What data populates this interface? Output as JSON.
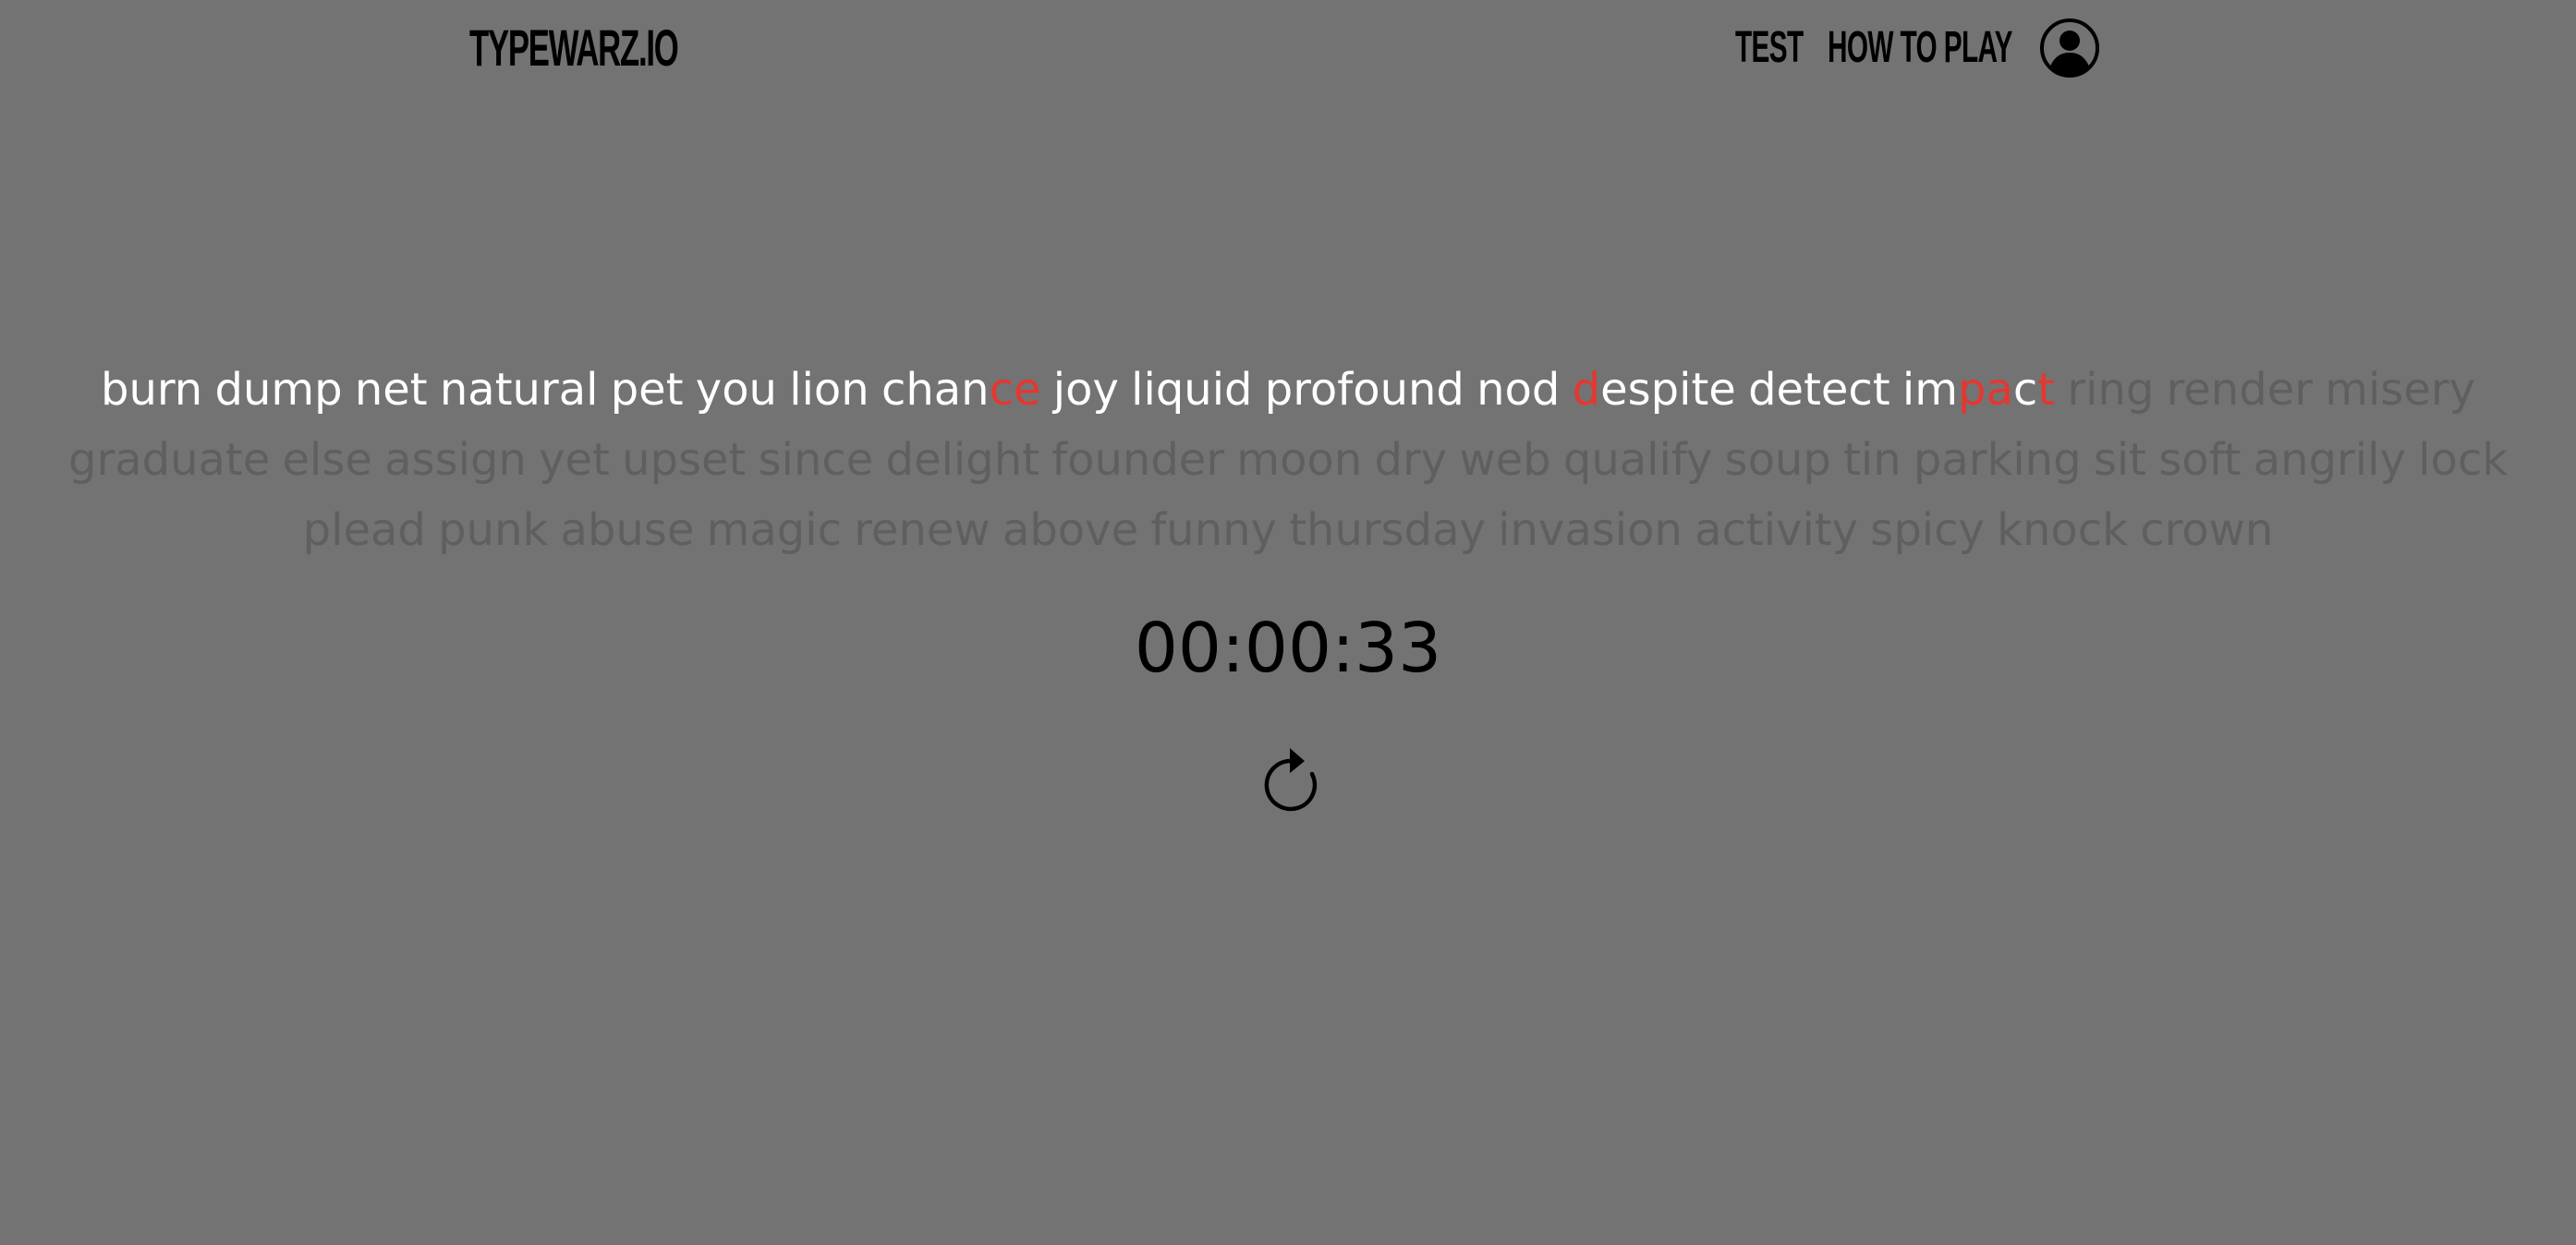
{
  "header": {
    "logo": "TYPEWARZ.IO",
    "nav": {
      "test_label": "TEST",
      "how_to_play_label": "HOW TO PLAY"
    },
    "profile_icon": "user-circle-icon"
  },
  "passage": {
    "segments": [
      {
        "text": "burn dump net natural pet you lion chan",
        "state": "typed"
      },
      {
        "text": "ce",
        "state": "error"
      },
      {
        "text": " joy liquid profound nod ",
        "state": "typed"
      },
      {
        "text": "d",
        "state": "error"
      },
      {
        "text": "espite detect im",
        "state": "typed"
      },
      {
        "text": "pa",
        "state": "error"
      },
      {
        "text": "c",
        "state": "typed"
      },
      {
        "text": "t",
        "state": "error"
      },
      {
        "text": " ring render misery graduate else assign yet upset since delight founder moon dry web qualify soup tin parking sit soft angrily lock plead punk abuse magic renew above funny thursday invasion activity spicy knock crown",
        "state": "pending"
      }
    ]
  },
  "timer": {
    "value": "00:00:33"
  },
  "restart_icon": "restart-icon",
  "colors": {
    "background": "#737373",
    "typed": "#ffffff",
    "error": "#e5372f",
    "pending": "#5f5f5f",
    "ink": "#000000"
  }
}
